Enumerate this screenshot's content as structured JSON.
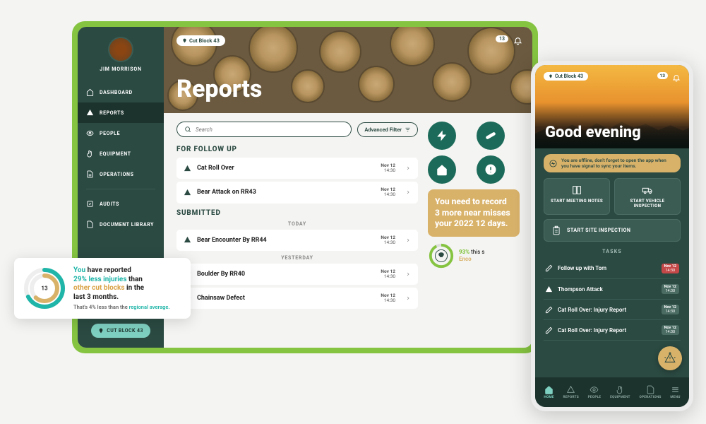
{
  "desktop": {
    "user": {
      "name": "JIM MORRISON"
    },
    "nav": {
      "items": [
        {
          "label": "DASHBOARD",
          "icon": "home"
        },
        {
          "label": "REPORTS",
          "icon": "warning",
          "active": true
        },
        {
          "label": "PEOPLE",
          "icon": "eye"
        },
        {
          "label": "EQUIPMENT",
          "icon": "hand"
        },
        {
          "label": "OPERATIONS",
          "icon": "doc"
        }
      ],
      "lower": [
        {
          "label": "AUDITS",
          "icon": "check"
        },
        {
          "label": "DOCUMENT LIBRARY",
          "icon": "doc"
        }
      ]
    },
    "cutblock_pill": "CUT BLOCK 43",
    "header": {
      "pill": "Cut Block 43",
      "title": "Reports",
      "badge_count": "13"
    },
    "search": {
      "placeholder": "Search",
      "advanced_label": "Advanced Filter"
    },
    "sections": {
      "followup": {
        "title": "FOR FOLLOW UP",
        "items": [
          {
            "title": "Cat Roll Over",
            "date": "Nov 12",
            "time": "14:30"
          },
          {
            "title": "Bear Attack on RR43",
            "date": "Nov 12",
            "time": "14:30"
          }
        ]
      },
      "submitted": {
        "title": "SUBMITTED",
        "groups": [
          {
            "label": "TODAY",
            "items": [
              {
                "title": "Bear Encounter By RR44",
                "date": "Nov 12",
                "time": "14:30"
              }
            ]
          },
          {
            "label": "YESTERDAY",
            "items": [
              {
                "title": "Boulder By RR40",
                "date": "Nov 12",
                "time": "14:30"
              },
              {
                "title": "Chainsaw Defect",
                "date": "Nov 12",
                "time": "14:30"
              }
            ]
          }
        ]
      }
    },
    "yellow_card": "You need to record 3 more near misses your 2022 12 days.",
    "encounter": {
      "pct": "93%",
      "line1": "this s",
      "line2": "Enco"
    }
  },
  "float": {
    "center": "13",
    "line1_pre": "You ",
    "line1_post": "have reported",
    "line2_pre": "29% less injuries ",
    "line2_mid": "than",
    "line3_pre": "other cut blocks ",
    "line3_post": "in the",
    "line4": "last 3 months.",
    "sub_pre": "That's 4% less than the ",
    "sub_highlight": "regional average."
  },
  "mobile": {
    "header": {
      "pill": "Cut Block 43",
      "badge": "13",
      "greeting": "Good evening"
    },
    "offline_msg": "You are offline, don't forget to open the app when you have signal to sync your items.",
    "actions": {
      "meeting": "START MEETING NOTES",
      "vehicle": "START VEHICLE INSPECTION",
      "site": "START SITE INSPECTION"
    },
    "tasks_header": "TASKS",
    "tasks": [
      {
        "title": "Follow up with Tom",
        "date": "Nov 12",
        "time": "14:30",
        "urgent": true,
        "icon": "pencil"
      },
      {
        "title": "Thompson Attack",
        "date": "Nov 12",
        "time": "14:30",
        "icon": "warning"
      },
      {
        "title": "Cat Roll Over: Injury Report",
        "date": "Nov 12",
        "time": "14:30",
        "icon": "pencil"
      },
      {
        "title": "Cat Roll Over: Injury Report",
        "date": "Nov 12",
        "time": "14:30",
        "icon": "pencil"
      }
    ],
    "bottom_nav": [
      {
        "label": "HOME",
        "icon": "home",
        "active": true
      },
      {
        "label": "REPORTS",
        "icon": "warning"
      },
      {
        "label": "PEOPLE",
        "icon": "eye"
      },
      {
        "label": "EQUIPMENT",
        "icon": "hand"
      },
      {
        "label": "OPERATIONS",
        "icon": "doc"
      },
      {
        "label": "MENU",
        "icon": "menu"
      }
    ]
  }
}
